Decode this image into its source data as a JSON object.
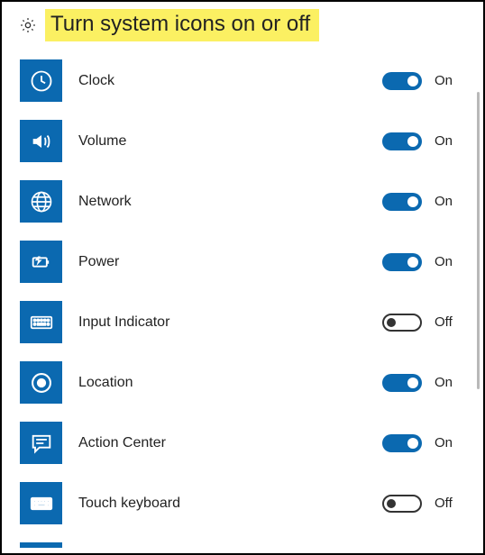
{
  "header": {
    "title": "Turn system icons on or off"
  },
  "state_labels": {
    "on": "On",
    "off": "Off"
  },
  "colors": {
    "accent": "#0b69b0",
    "highlight": "#fbf062"
  },
  "items": [
    {
      "icon": "clock-icon",
      "label": "Clock",
      "on": true
    },
    {
      "icon": "volume-icon",
      "label": "Volume",
      "on": true
    },
    {
      "icon": "network-icon",
      "label": "Network",
      "on": true
    },
    {
      "icon": "power-icon",
      "label": "Power",
      "on": true
    },
    {
      "icon": "input-indicator-icon",
      "label": "Input Indicator",
      "on": false
    },
    {
      "icon": "location-icon",
      "label": "Location",
      "on": true
    },
    {
      "icon": "action-center-icon",
      "label": "Action Center",
      "on": true
    },
    {
      "icon": "touch-keyboard-icon",
      "label": "Touch keyboard",
      "on": false
    }
  ]
}
